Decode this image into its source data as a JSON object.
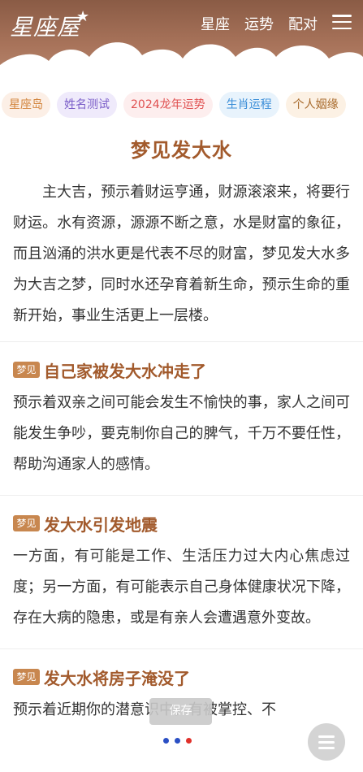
{
  "header": {
    "logo_text": "星座屋",
    "logo_star": "★",
    "nav": [
      "星座",
      "运势",
      "配对"
    ],
    "bg_color": "#9a664e"
  },
  "tags": [
    "星座岛",
    "姓名测试",
    "2024龙年运势",
    "生肖运程",
    "个人姻缘"
  ],
  "article": {
    "title": "梦见发大水",
    "intro": "主大吉，预示着财运亨通，财源滚滚来，将要行财运。水有资源，源源不断之意，水是财富的象征，而且汹涌的洪水更是代表不尽的财富，梦见发大水多为大吉之梦，同时水还孕育着新生命，预示生命的重新开始，事业生活更上一层楼。",
    "badge": "梦见",
    "sections": [
      {
        "heading": "自己家被发大水冲走了",
        "text": "预示着双亲之间可能会发生不愉快的事，家人之间可能发生争吵，要克制你自己的脾气，千万不要任性，帮助沟通家人的感情。"
      },
      {
        "heading": "发大水引发地震",
        "text": "一方面，有可能是工作、生活压力过大内心焦虑过度；另一方面，有可能表示自己身体健康状况下降，存在大病的隐患，或是有亲人会遭遇意外变故。"
      },
      {
        "heading": "发大水将房子淹没了",
        "text": "预示着近期你的潜意识中，有被掌控、不"
      }
    ]
  },
  "overlay": {
    "save_label": "保存",
    "menu_icon": "hamburger-icon"
  },
  "colors": {
    "accent": "#a25a2c",
    "badge": "#c8874f"
  }
}
